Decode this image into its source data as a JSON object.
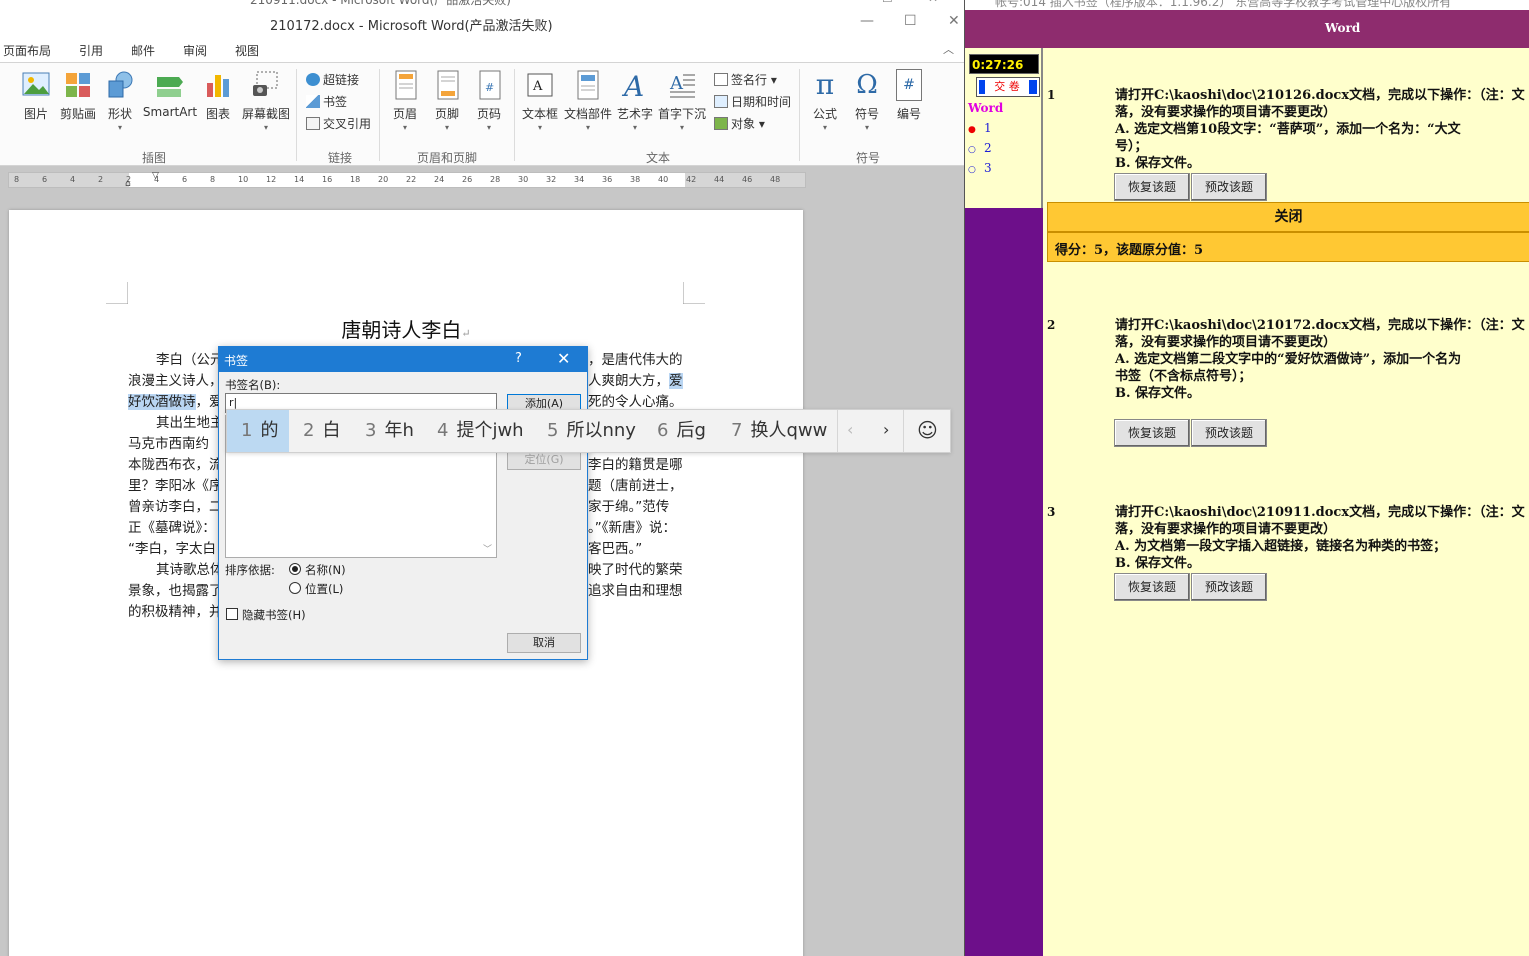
{
  "word": {
    "behind_title": "210911.docx - Microsoft Word(产品激活失败)",
    "window_title": "210172.docx - Microsoft Word(产品激活失败)",
    "window_controls": [
      "—",
      "☐",
      "✕"
    ],
    "tabs": [
      "页面布局",
      "引用",
      "邮件",
      "审阅",
      "视图"
    ],
    "ribbon": {
      "illustrations": [
        "图片",
        "剪贴画",
        "形状",
        "SmartArt",
        "图表",
        "屏幕截图"
      ],
      "links": [
        "超链接",
        "书签",
        "交叉引用"
      ],
      "header_footer": [
        "页眉",
        "页脚",
        "页码"
      ],
      "text_big": [
        "文本框",
        "文档部件",
        "艺术字",
        "首字下沉"
      ],
      "text_small": [
        "签名行",
        "日期和时间",
        "对象"
      ],
      "symbols": [
        "公式",
        "符号",
        "编号"
      ],
      "symbol_glyphs": [
        "π",
        "Ω",
        "#"
      ],
      "groups": [
        "插图",
        "链接",
        "页眉和页脚",
        "文本",
        "符号"
      ]
    },
    "ruler_ticks": [
      "8",
      "6",
      "4",
      "2",
      "2",
      "4",
      "6",
      "8",
      "10",
      "12",
      "14",
      "16",
      "18",
      "20",
      "22",
      "24",
      "26",
      "28",
      "30",
      "32",
      "34",
      "36",
      "38",
      "40",
      "42",
      "44",
      "46",
      "48"
    ],
    "document": {
      "title": "唐朝诗人李白",
      "lines": [
        {
          "a": "李白（公元",
          "b": "，是唐代伟大的"
        },
        {
          "a": "浪漫主义诗人，",
          "b": "人爽朗大方，",
          "c": "爱"
        },
        {
          "a_hl": "好饮酒做诗",
          "a": "，爱",
          "b": "死的令人心痛。"
        },
        {
          "a": "其出生地主",
          "b": ""
        },
        {
          "a": "马克市西南约",
          "b": ""
        },
        {
          "a": "本陇西布衣，流",
          "b": "李白的籍贯是哪"
        },
        {
          "a": "里？李阳冰《序",
          "b": "题（唐前进士，"
        },
        {
          "a": "曾亲访李白，二",
          "b": "家于绵。”范传"
        },
        {
          "a": "正《墓碑说》：",
          "b": "。”《新唐》说："
        },
        {
          "a": "“李白，字太白",
          "b": "客巴西。”"
        },
        {
          "a": "其诗歌总体",
          "b": "映了时代的繁荣"
        },
        {
          "a": "景象，也揭露了",
          "b": "追求自由和理想"
        },
        {
          "a": "的积极精神，并",
          "b": ""
        }
      ]
    }
  },
  "bookmark_dialog": {
    "title": "书签",
    "help": "?",
    "close": "✕",
    "name_label": "书签名(B):",
    "name_value": "r|",
    "add_button": "添加(A)",
    "goto_button": "定位(G)",
    "sort_label": "排序依据:",
    "sort_by_name": "名称(N)",
    "sort_by_location": "位置(L)",
    "hidden_label": "隐藏书签(H)",
    "cancel_button": "取消"
  },
  "ime": {
    "candidates": [
      {
        "n": "1",
        "t": "的"
      },
      {
        "n": "2",
        "t": "白"
      },
      {
        "n": "3",
        "t": "年h"
      },
      {
        "n": "4",
        "t": "提个jwh"
      },
      {
        "n": "5",
        "t": "所以nny"
      },
      {
        "n": "6",
        "t": "后g"
      },
      {
        "n": "7",
        "t": "换人qww"
      }
    ],
    "prev": "‹",
    "next": "›",
    "emoji": "☺"
  },
  "exam": {
    "top_strip": "帐号:014  插入书签（程序版本：1.1.96.2）  东营高等学校教学考试管理中心版权所有",
    "header": "Word",
    "timer": "0:27:26",
    "submit": "交 卷",
    "side_label": "Word",
    "nav": [
      {
        "mark": "●",
        "num": "1"
      },
      {
        "mark": "○",
        "num": "2"
      },
      {
        "mark": "○",
        "num": "3"
      }
    ],
    "close": "关闭",
    "score": "得分：5，该题原分值：5",
    "restore": "恢复该题",
    "preview": "预改该题",
    "questions": [
      {
        "num": "1",
        "lines": [
          "请打开C:\\kaoshi\\doc\\210126.docx文档，完成以下操作：（注：文",
          "落，没有要求操作的项目请不要更改）",
          "A. 选定文档第10段文字：“菩萨项”，添加一个名为：“大文",
          "号）；",
          "B. 保存文件。"
        ]
      },
      {
        "num": "2",
        "lines": [
          "请打开C:\\kaoshi\\doc\\210172.docx文档，完成以下操作：（注：文",
          "落，没有要求操作的项目请不要更改）",
          "A. 选定文档第二段文字中的“爱好饮酒做诗”，添加一个名为",
          "书签（不含标点符号）；",
          "B. 保存文件。"
        ]
      },
      {
        "num": "3",
        "lines": [
          "请打开C:\\kaoshi\\doc\\210911.docx文档，完成以下操作：（注：文",
          "落，没有要求操作的项目请不要更改）",
          "A. 为文档第一段文字插入超链接，链接名为种类的书签；",
          "B. 保存文件。"
        ]
      }
    ]
  }
}
